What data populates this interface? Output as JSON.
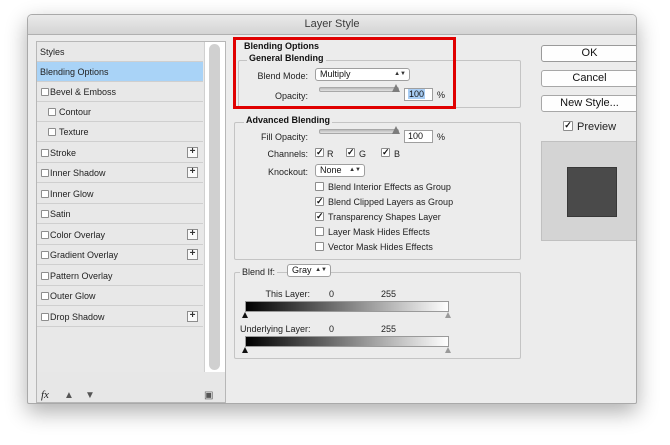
{
  "window": {
    "title": "Layer Style"
  },
  "sidebar": {
    "items": [
      {
        "label": "Styles"
      },
      {
        "label": "Blending Options"
      },
      {
        "label": "Bevel & Emboss"
      },
      {
        "label": "Contour"
      },
      {
        "label": "Texture"
      },
      {
        "label": "Stroke"
      },
      {
        "label": "Inner Shadow"
      },
      {
        "label": "Inner Glow"
      },
      {
        "label": "Satin"
      },
      {
        "label": "Color Overlay"
      },
      {
        "label": "Gradient Overlay"
      },
      {
        "label": "Pattern Overlay"
      },
      {
        "label": "Outer Glow"
      },
      {
        "label": "Drop Shadow"
      }
    ],
    "fx_label": "fx"
  },
  "blending": {
    "title": "Blending Options",
    "general": {
      "title": "General Blending",
      "blend_mode_label": "Blend Mode:",
      "blend_mode_value": "Multiply",
      "opacity_label": "Opacity:",
      "opacity_value": "100",
      "opacity_unit": "%",
      "opacity_level": 1.0
    },
    "advanced": {
      "title": "Advanced Blending",
      "fill_opacity_label": "Fill Opacity:",
      "fill_opacity_value": "100",
      "fill_opacity_unit": "%",
      "fill_opacity_level": 1.0,
      "channels_label": "Channels:",
      "channel_r": "R",
      "channel_g": "G",
      "channel_b": "B",
      "knockout_label": "Knockout:",
      "knockout_value": "None",
      "options": [
        {
          "label": "Blend Interior Effects as Group",
          "checked": false
        },
        {
          "label": "Blend Clipped Layers as Group",
          "checked": true
        },
        {
          "label": "Transparency Shapes Layer",
          "checked": true
        },
        {
          "label": "Layer Mask Hides Effects",
          "checked": false
        },
        {
          "label": "Vector Mask Hides Effects",
          "checked": false
        }
      ]
    },
    "blend_if": {
      "label": "Blend If:",
      "value": "Gray",
      "this_layer_label": "This Layer:",
      "this_layer_min": "0",
      "this_layer_max": "255",
      "underlying_label": "Underlying Layer:",
      "underlying_min": "0",
      "underlying_max": "255"
    }
  },
  "buttons": {
    "ok": "OK",
    "cancel": "Cancel",
    "new_style": "New Style...",
    "preview_label": "Preview"
  },
  "colors": {
    "selected_row": "#a9d3f7",
    "highlight_box": "#e00000",
    "preview_swatch": "#4a4a4a"
  }
}
